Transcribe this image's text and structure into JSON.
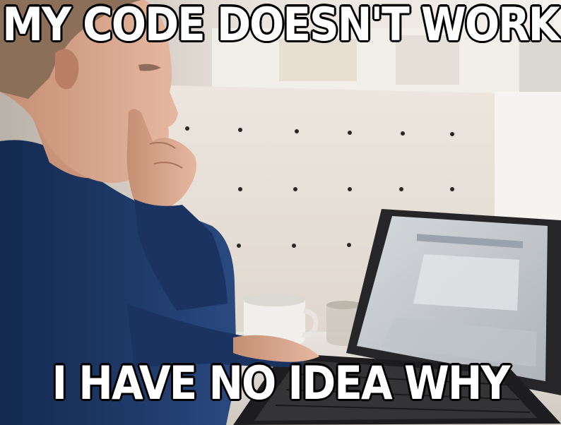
{
  "meme": {
    "top_text": "MY CODE DOESN'T WORK",
    "bottom_text": "I HAVE NO IDEA WHY"
  },
  "colors": {
    "caption_fill": "#ffffff",
    "caption_stroke": "#000000",
    "shirt": "#1f3b6a",
    "skin": "#d9a68c",
    "wall": "#e6ded5",
    "laptop_frame": "#2a2a2c",
    "laptop_screen": "#c8ccd0"
  },
  "icons": [
    "laptop-icon",
    "coffee-mug-icon",
    "pegboard-dots"
  ]
}
